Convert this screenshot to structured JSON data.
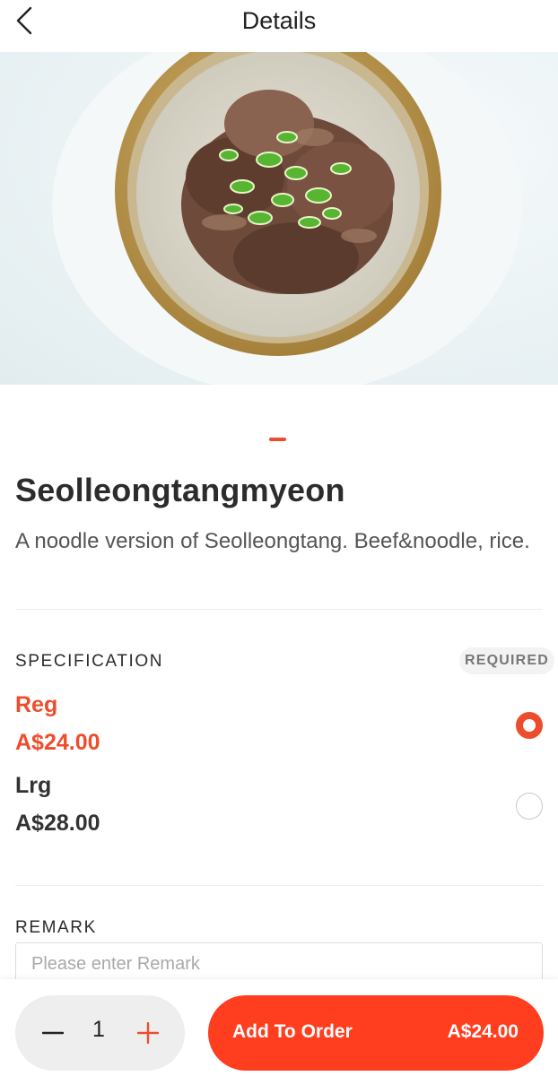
{
  "header": {
    "title": "Details",
    "back_icon": "chevron-left-icon"
  },
  "product": {
    "name": "Seolleongtangmyeon",
    "description": "A noodle version of Seolleongtang. Beef&noodle, rice.",
    "image_alt": "Bowl of beef noodle soup topped with green onions"
  },
  "specification": {
    "label": "SPECIFICATION",
    "badge": "REQUIRED",
    "options": [
      {
        "name": "Reg",
        "price": "A$24.00",
        "selected": true
      },
      {
        "name": "Lrg",
        "price": "A$28.00",
        "selected": false
      }
    ]
  },
  "remark": {
    "label": "REMARK",
    "placeholder": "Please enter Remark",
    "value": ""
  },
  "order": {
    "quantity": "1",
    "add_label": "Add To Order",
    "total": "A$24.00"
  },
  "colors": {
    "accent": "#ee4d2d",
    "button": "#ff3d1f",
    "stepper_bg": "#eeeeee"
  }
}
